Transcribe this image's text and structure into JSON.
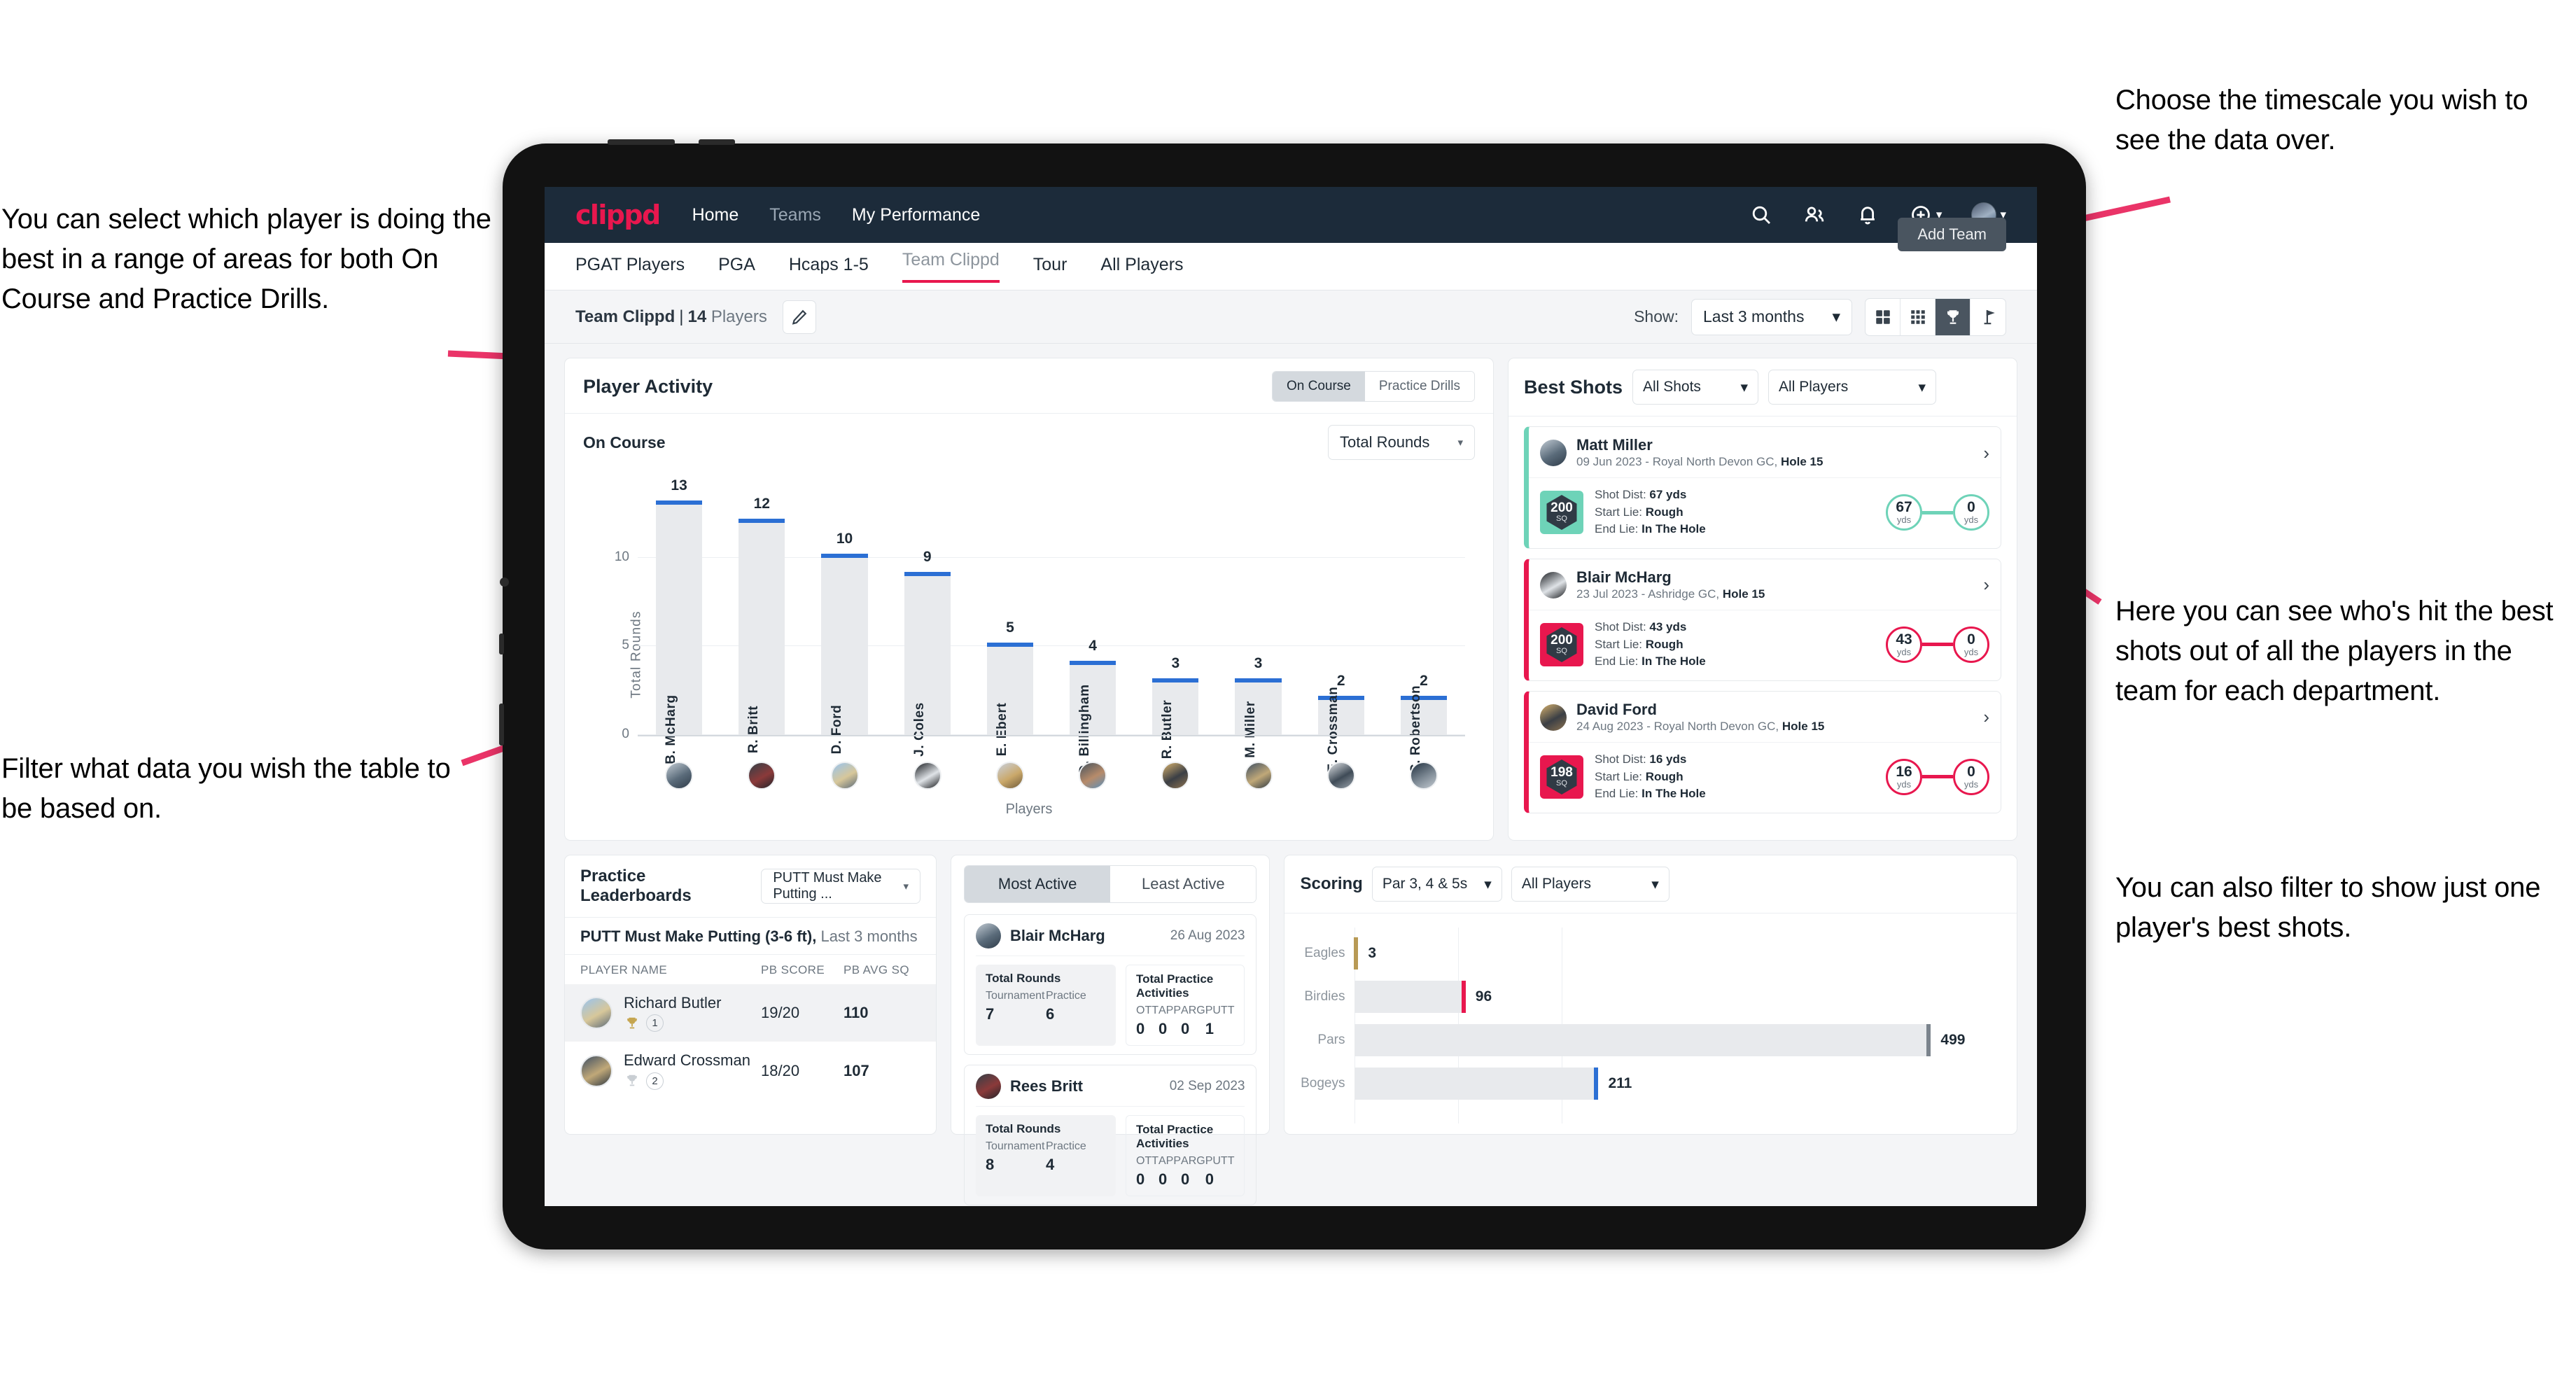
{
  "annotations": {
    "left_top": "You can select which player is doing the best in a range of areas for both On Course and Practice Drills.",
    "left_bottom": "Filter what data you wish the table to be based on.",
    "right_top": "Choose the timescale you wish to see the data over.",
    "right_middle": "Here you can see who's hit the best shots out of all the players in the team for each department.",
    "right_bottom": "You can also filter to show just one player's best shots."
  },
  "topnav": {
    "brand": "clippd",
    "links": [
      {
        "label": "Home",
        "active": true
      },
      {
        "label": "Teams",
        "active": false
      },
      {
        "label": "My Performance",
        "active": true
      }
    ],
    "icons": [
      "search-icon",
      "people-icon",
      "bell-icon",
      "plus-circle-icon",
      "avatar"
    ]
  },
  "tabs": [
    {
      "label": "PGAT Players",
      "active": false
    },
    {
      "label": "PGA",
      "active": false
    },
    {
      "label": "Hcaps 1-5",
      "active": false
    },
    {
      "label": "Team Clippd",
      "active": true
    },
    {
      "label": "Tour",
      "active": false
    },
    {
      "label": "All Players",
      "active": false
    }
  ],
  "add_team_button": "Add Team",
  "subbar": {
    "team_name": "Team Clippd",
    "separator": "|",
    "player_count": "14",
    "players_word": "Players",
    "edit_icon": "pencil-icon",
    "show_label": "Show:",
    "period_value": "Last 3 months",
    "view_modes": [
      "grid-large-icon",
      "grid-small-icon",
      "trophy-icon",
      "flag-icon"
    ],
    "active_view_mode": 2
  },
  "player_activity": {
    "title": "Player Activity",
    "segments": [
      {
        "label": "On Course",
        "active": true
      },
      {
        "label": "Practice Drills",
        "active": false
      }
    ],
    "sub_title": "On Course",
    "metric_select": "Total Rounds",
    "x_axis_label": "Players",
    "y_axis_label": "Total Rounds"
  },
  "chart_data": [
    {
      "type": "bar",
      "title": "Player Activity - On Course",
      "xlabel": "Players",
      "ylabel": "Total Rounds",
      "categories": [
        "B. McHarg",
        "R. Britt",
        "D. Ford",
        "J. Coles",
        "E. Ebert",
        "D. Billingham",
        "R. Butler",
        "M. Miller",
        "E. Crossman",
        "C. Robertson"
      ],
      "values": [
        13,
        12,
        10,
        9,
        5,
        4,
        3,
        3,
        2,
        2
      ],
      "ylim": [
        0,
        14
      ],
      "yticks": [
        0,
        5,
        10
      ],
      "grid": true,
      "bar_color": "#e8eaed",
      "cap_color": "#2b6fd4",
      "legend": "none"
    },
    {
      "type": "bar",
      "orientation": "horizontal",
      "title": "Scoring",
      "categories": [
        "Eagles",
        "Birdies",
        "Pars",
        "Bogeys"
      ],
      "values": [
        3,
        96,
        499,
        211
      ],
      "xlim": [
        0,
        560
      ],
      "grid": true,
      "tip_colors": [
        "#b89a55",
        "#e8174e",
        "#7b848d",
        "#2b6fd4"
      ],
      "legend": "none"
    }
  ],
  "best_shots": {
    "title": "Best Shots",
    "shot_filter": "All Shots",
    "player_filter": "All Players",
    "shots": [
      {
        "name": "Matt Miller",
        "meta_prefix": "09 Jun 2023 - Royal North Devon GC,",
        "hole": "Hole 15",
        "quality": "200",
        "quality_unit": "SQ",
        "accent": "#6ed3b8",
        "shot_dist_label": "Shot Dist:",
        "shot_dist": "67 yds",
        "start_lie_label": "Start Lie:",
        "start_lie": "Rough",
        "end_lie_label": "End Lie:",
        "end_lie": "In The Hole",
        "from_value": "67",
        "from_unit": "yds",
        "to_value": "0",
        "to_unit": "yds"
      },
      {
        "name": "Blair McHarg",
        "meta_prefix": "23 Jul 2023 - Ashridge GC,",
        "hole": "Hole 15",
        "quality": "200",
        "quality_unit": "SQ",
        "accent": "#e8174e",
        "shot_dist_label": "Shot Dist:",
        "shot_dist": "43 yds",
        "start_lie_label": "Start Lie:",
        "start_lie": "Rough",
        "end_lie_label": "End Lie:",
        "end_lie": "In The Hole",
        "from_value": "43",
        "from_unit": "yds",
        "to_value": "0",
        "to_unit": "yds"
      },
      {
        "name": "David Ford",
        "meta_prefix": "24 Aug 2023 - Royal North Devon GC,",
        "hole": "Hole 15",
        "quality": "198",
        "quality_unit": "SQ",
        "accent": "#e8174e",
        "shot_dist_label": "Shot Dist:",
        "shot_dist": "16 yds",
        "start_lie_label": "Start Lie:",
        "start_lie": "Rough",
        "end_lie_label": "End Lie:",
        "end_lie": "In The Hole",
        "from_value": "16",
        "from_unit": "yds",
        "to_value": "0",
        "to_unit": "yds"
      }
    ]
  },
  "practice_leaderboards": {
    "title": "Practice Leaderboards",
    "drill_select": "PUTT Must Make Putting ...",
    "sub_title": "PUTT Must Make Putting (3-6 ft),",
    "sub_period": "Last 3 months",
    "columns": [
      "PLAYER NAME",
      "PB SCORE",
      "PB AVG SQ"
    ],
    "rows": [
      {
        "name": "Richard Butler",
        "rank": "1",
        "trophy": "gold",
        "pb_score": "19/20",
        "pb_avg_sq": "110"
      },
      {
        "name": "Edward Crossman",
        "rank": "2",
        "trophy": "silver",
        "pb_score": "18/20",
        "pb_avg_sq": "107"
      }
    ]
  },
  "activity": {
    "tabs": [
      {
        "label": "Most Active",
        "active": true
      },
      {
        "label": "Least Active",
        "active": false
      }
    ],
    "cards": [
      {
        "name": "Blair McHarg",
        "date": "26 Aug 2023",
        "rounds_title": "Total Rounds",
        "rounds": [
          {
            "key": "Tournament",
            "value": "7"
          },
          {
            "key": "Practice",
            "value": "6"
          }
        ],
        "practice_title": "Total Practice Activities",
        "practice": [
          {
            "key": "OTT",
            "value": "0"
          },
          {
            "key": "APP",
            "value": "0"
          },
          {
            "key": "ARG",
            "value": "0"
          },
          {
            "key": "PUTT",
            "value": "1"
          }
        ]
      },
      {
        "name": "Rees Britt",
        "date": "02 Sep 2023",
        "rounds_title": "Total Rounds",
        "rounds": [
          {
            "key": "Tournament",
            "value": "8"
          },
          {
            "key": "Practice",
            "value": "4"
          }
        ],
        "practice_title": "Total Practice Activities",
        "practice": [
          {
            "key": "OTT",
            "value": "0"
          },
          {
            "key": "APP",
            "value": "0"
          },
          {
            "key": "ARG",
            "value": "0"
          },
          {
            "key": "PUTT",
            "value": "0"
          }
        ]
      }
    ]
  },
  "scoring": {
    "title": "Scoring",
    "par_filter": "Par 3, 4 & 5s",
    "player_filter": "All Players",
    "rows": [
      {
        "label": "Eagles",
        "value": "3"
      },
      {
        "label": "Birdies",
        "value": "96"
      },
      {
        "label": "Pars",
        "value": "499"
      },
      {
        "label": "Bogeys",
        "value": "211"
      }
    ]
  },
  "colors": {
    "brand": "#e8174e",
    "nav_bg": "#1c2b3a",
    "page_bg": "#f4f5f7",
    "bar": "#e8eaed",
    "bar_cap": "#2b6fd4",
    "teal": "#6ed3b8"
  }
}
